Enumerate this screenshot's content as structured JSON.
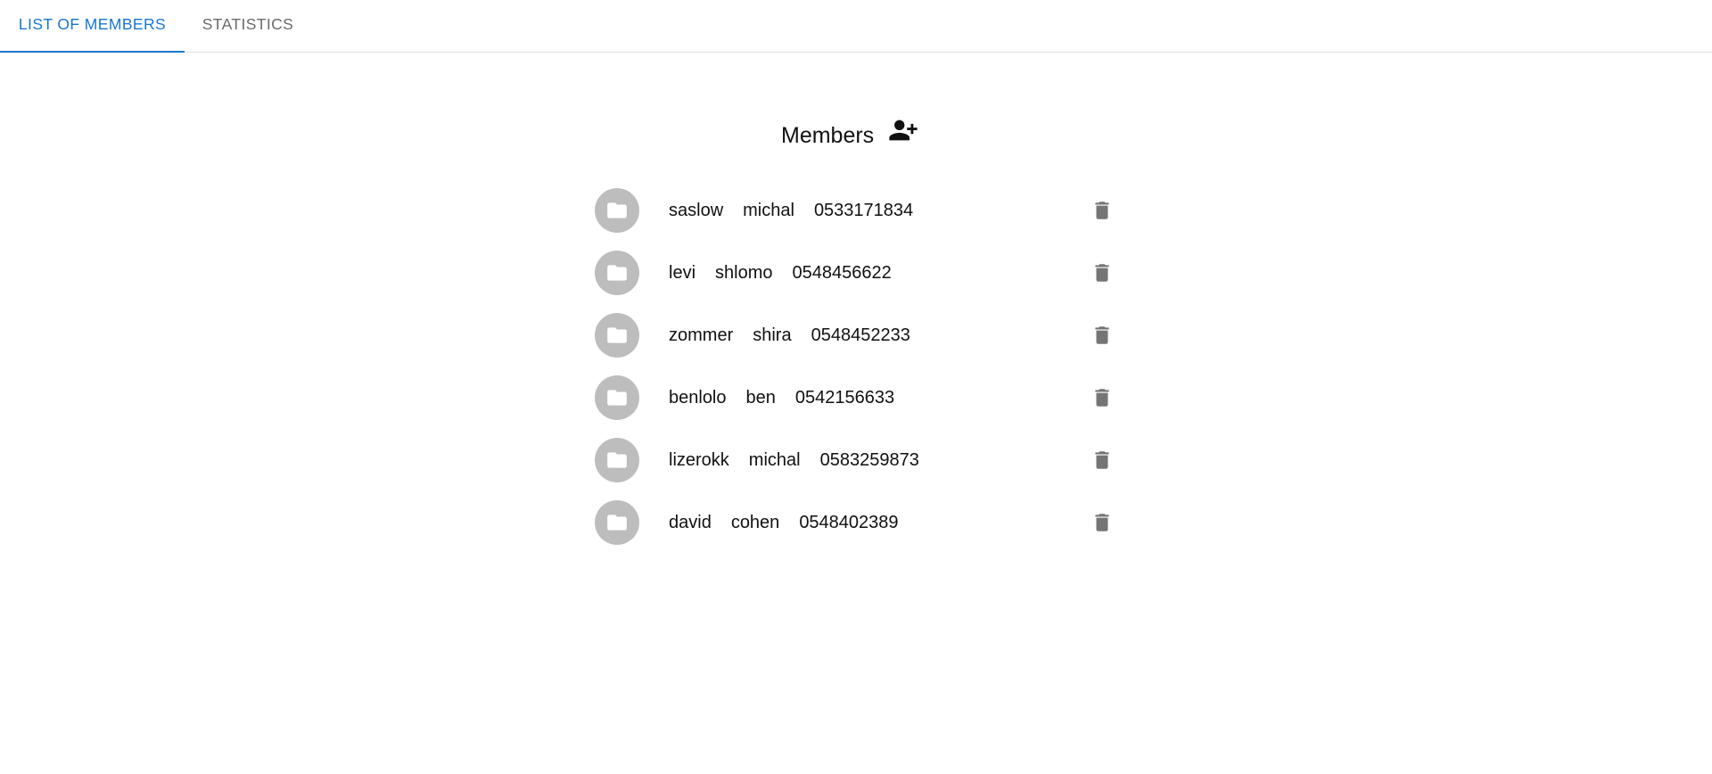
{
  "tabs": [
    {
      "label": "LIST OF MEMBERS",
      "active": true
    },
    {
      "label": "STATISTICS",
      "active": false
    }
  ],
  "main": {
    "title": "Members",
    "add_icon": "person-add-icon"
  },
  "members": [
    {
      "last": "saslow",
      "first": "michal",
      "phone": "0533171834"
    },
    {
      "last": "levi",
      "first": "shlomo",
      "phone": "0548456622"
    },
    {
      "last": "zommer",
      "first": "shira",
      "phone": "0548452233"
    },
    {
      "last": "benlolo",
      "first": "ben",
      "phone": "0542156633"
    },
    {
      "last": "lizerokk",
      "first": "michal",
      "phone": "0583259873"
    },
    {
      "last": "david",
      "first": "cohen",
      "phone": "0548402389"
    }
  ],
  "colors": {
    "accent": "#1976d2",
    "avatar_bg": "#bdbdbd",
    "delete_icon": "#757575"
  },
  "icons": {
    "avatar": "folder-icon",
    "delete": "trash-icon"
  }
}
